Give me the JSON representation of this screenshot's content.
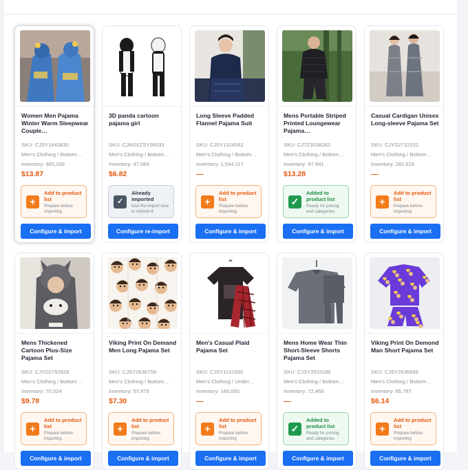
{
  "colors": {
    "accent": "#1a6ff2",
    "price": "#e4570c",
    "add_border": "#f5b27a",
    "added_border": "#93d6a4",
    "already_border": "#c9ced8"
  },
  "products": [
    {
      "title": "Women Men Pajama Winter Warm Sleepwear Couple…",
      "sku": "SKU: CJSY1643830",
      "category": "Men's Clothing / Bottom…",
      "inventory": "Inventory: 465,330",
      "price": "$13.87",
      "status": "add",
      "status_title": "Add to product list",
      "status_sub": "Prepare before importing",
      "status_icon": "plus-icon",
      "button": "Configure & import"
    },
    {
      "title": "3D panda cartoon pajama girl",
      "sku": "SKU: CJNSXZSY00033",
      "category": "Men's Clothing / Bottom…",
      "inventory": "Inventory: 47,064",
      "price": "$6.82",
      "status": "already",
      "status_title": "Already imported",
      "status_sub": "Use Re-import now to refresh it",
      "status_icon": "check-icon",
      "button": "Configure re-import"
    },
    {
      "title": "Long Sleeve Padded Flannel Pajama Suit",
      "sku": "SKU: CJSY1314562",
      "category": "Men's Clothing / Bottom…",
      "inventory": "Inventory: 1,544,117",
      "price": "—",
      "status": "add",
      "status_title": "Add to product list",
      "status_sub": "Prepare before importing",
      "status_icon": "plus-icon",
      "button": "Configure & import"
    },
    {
      "title": "Mens Portable Striped Printed Loungewear Pajama…",
      "sku": "SKU: CJTZ3038282",
      "category": "Men's Clothing / Bottom…",
      "inventory": "Inventory: 97,941",
      "price": "$13.28",
      "status": "added",
      "status_title": "Added to product list",
      "status_sub": "Ready for pricing and categories",
      "status_icon": "check-icon",
      "button": "Configure & import"
    },
    {
      "title": "Casual Cardigan Unisex Long-sleeve Pajama Set",
      "sku": "SKU: CJYD2732152",
      "category": "Men's Clothing / Bottom…",
      "inventory": "Inventory: 282,529",
      "price": "—",
      "status": "add",
      "status_title": "Add to product list",
      "status_sub": "Prepare before importing",
      "status_icon": "plus-icon",
      "button": "Configure & import"
    },
    {
      "title": "Mens Thickened Cartoon Plus-Size Pajama Set",
      "sku": "SKU: CJYD2752928",
      "category": "Men's Clothing / Bottom…",
      "inventory": "Inventory: 70,524",
      "price": "$9.78",
      "status": "add",
      "status_title": "Add to product list",
      "status_sub": "Prepare before importing",
      "status_icon": "plus-icon",
      "button": "Configure & import"
    },
    {
      "title": "Viking Print On Demand Men Long Pajama Set",
      "sku": "SKU: CJSY2636759",
      "category": "Men's Clothing / Bottom…",
      "inventory": "Inventory: 57,975",
      "price": "$7.30",
      "status": "add",
      "status_title": "Add to product list",
      "status_sub": "Prepare before importing",
      "status_icon": "plus-icon",
      "button": "Configure & import"
    },
    {
      "title": "Men's Casual Plaid Pajama Set",
      "sku": "SKU: CJSY1131690",
      "category": "Men's Clothing / Under…",
      "inventory": "Inventory: 160,000",
      "price": "—",
      "status": "add",
      "status_title": "Add to product list",
      "status_sub": "Prepare before importing",
      "status_icon": "plus-icon",
      "button": "Configure & import"
    },
    {
      "title": "Mens Home Wear Thin Short-Sleeve Shorts Pajama Set",
      "sku": "SKU: CJSY2915186",
      "category": "Men's Clothing / Bottom…",
      "inventory": "Inventory: 72,468",
      "price": "—",
      "status": "added",
      "status_title": "Added to product list",
      "status_sub": "Ready for pricing and categories",
      "status_icon": "check-icon",
      "button": "Configure & import"
    },
    {
      "title": "Viking Print On Demond Man Short Pajama Set",
      "sku": "SKU: CJSY2636669",
      "category": "Men's Clothing / Bottom…",
      "inventory": "Inventory: 65,787",
      "price": "$6.14",
      "status": "add",
      "status_title": "Add to product list",
      "status_sub": "Prepare before importing",
      "status_icon": "plus-icon",
      "button": "Configure & import"
    }
  ]
}
